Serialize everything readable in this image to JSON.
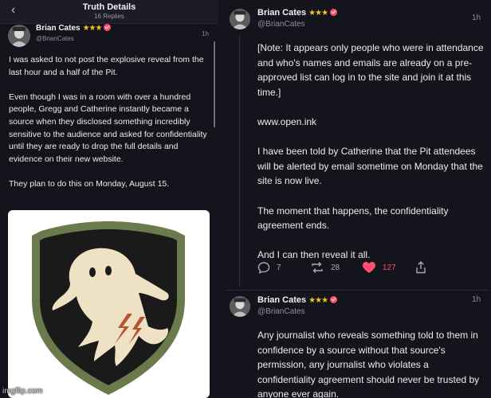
{
  "left": {
    "header": {
      "title": "Truth Details",
      "subtitle": "16 Replies"
    },
    "post": {
      "author": "Brian Cates",
      "handle": "@BrianCates",
      "time": "1h",
      "paragraphs": [
        "I was asked to not post the explosive reveal from the last hour and a half of the Pit.",
        "Even though I was in a room with over a hundred people, Gregg and Catherine instantly became a source when they disclosed something incredibly sensitive to the audience and asked for confidentiality until they are ready to drop the full details and evidence on their new website.",
        "They plan to do this on Monday, August 15."
      ]
    },
    "watermark": "imgflip.com"
  },
  "right": {
    "post1": {
      "author": "Brian Cates",
      "handle": "@BrianCates",
      "time": "1h",
      "paragraphs": [
        "[Note: It appears only people who were in attendance and who's names and emails are already on a pre-approved list can log in to the site and join it at this time.]",
        "www.open.ink",
        "I have been told by Catherine that the Pit attendees will be alerted by email sometime on Monday that the site is now live.",
        "The moment that happens, the confidentiality agreement ends.",
        "And I can then reveal it all."
      ],
      "actions": {
        "replies": "7",
        "retruths": "28",
        "likes": "127"
      }
    },
    "post2": {
      "author": "Brian Cates",
      "handle": "@BrianCates",
      "time": "1h",
      "paragraphs": [
        "Any journalist who reveals something told to them in confidence by a source without that source's permission, any journalist who violates a confidentiality agreement should never be trusted by anyone ever again."
      ]
    }
  },
  "colors": {
    "background": "#13131b",
    "like": "#ff4d6d",
    "badge_star": "#f5c518",
    "shield_outer": "#6b7a4a",
    "shield_inner": "#1a1a1a",
    "ghost": "#eee1c4",
    "lightning": "#b5542c"
  },
  "icons": [
    "back-chevron-icon",
    "star-badge-icon",
    "verified-check-icon",
    "reply-icon",
    "retruth-icon",
    "heart-icon",
    "share-icon",
    "ghost-shield-image"
  ]
}
